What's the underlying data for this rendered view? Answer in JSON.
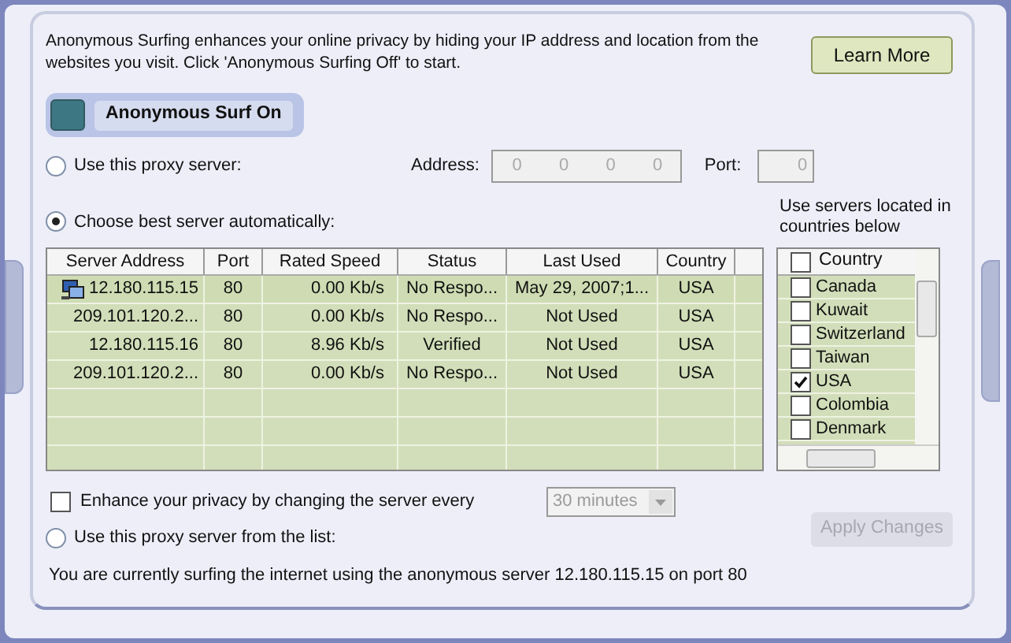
{
  "intro": "Anonymous Surfing enhances your online privacy by hiding your IP address and location from the websites you visit. Click 'Anonymous Surfing Off' to start.",
  "learn_more": "Learn More",
  "surf_toggle": {
    "label": "Anonymous Surf On",
    "on": true
  },
  "use_proxy": {
    "label": "Use this proxy server:",
    "selected": false
  },
  "address": {
    "label": "Address:",
    "octets": [
      "0",
      "0",
      "0",
      "0"
    ]
  },
  "port": {
    "label": "Port:",
    "value": "0"
  },
  "auto": {
    "label": "Choose best server automatically:",
    "selected": true
  },
  "countries_hint": "Use servers located in countries below",
  "table": {
    "columns": [
      "Server Address",
      "Port",
      "Rated Speed",
      "Status",
      "Last Used",
      "Country"
    ],
    "rows": [
      {
        "cells": [
          "12.180.115.15",
          "80",
          "0.00 Kb/s",
          "No Respo...",
          "May 29, 2007;1...",
          "USA"
        ],
        "current": true
      },
      {
        "cells": [
          "209.101.120.2...",
          "80",
          "0.00 Kb/s",
          "No Respo...",
          "Not Used",
          "USA"
        ],
        "current": false
      },
      {
        "cells": [
          "12.180.115.16",
          "80",
          "8.96 Kb/s",
          "Verified",
          "Not Used",
          "USA"
        ],
        "current": false
      },
      {
        "cells": [
          "209.101.120.2...",
          "80",
          "0.00 Kb/s",
          "No Respo...",
          "Not Used",
          "USA"
        ],
        "current": false
      }
    ]
  },
  "countries": {
    "header": {
      "label": "Country",
      "checked": false
    },
    "items": [
      {
        "label": "Canada",
        "checked": false
      },
      {
        "label": "Kuwait",
        "checked": false
      },
      {
        "label": "Switzerland",
        "checked": false
      },
      {
        "label": "Taiwan",
        "checked": false
      },
      {
        "label": "USA",
        "checked": true
      },
      {
        "label": "Colombia",
        "checked": false
      },
      {
        "label": "Denmark",
        "checked": false
      }
    ]
  },
  "enhance": {
    "label": "Enhance your privacy by changing the server every",
    "checked": false
  },
  "interval": {
    "value": "30 minutes",
    "disabled": true
  },
  "use_list": {
    "label": "Use this proxy server from the list:",
    "selected": false
  },
  "apply": {
    "label": "Apply Changes",
    "disabled": true
  },
  "status": "You are currently surfing the internet using the anonymous server 12.180.115.15 on port 80"
}
